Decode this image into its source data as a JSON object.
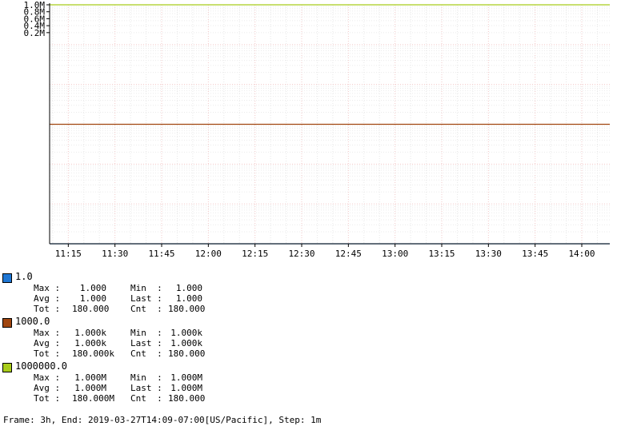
{
  "chart_data": {
    "type": "line",
    "y_axis": {
      "tick_labels": [
        "0.2M",
        "0.4M",
        "0.6M",
        "0.8M",
        "1.0M"
      ],
      "tick_values": [
        200000,
        400000,
        600000,
        800000,
        1000000
      ],
      "scale": "log",
      "ylim": [
        1,
        1000000
      ]
    },
    "x_axis": {
      "tick_labels": [
        "11:15",
        "11:30",
        "11:45",
        "12:00",
        "12:15",
        "12:30",
        "12:45",
        "13:00",
        "13:15",
        "13:30",
        "13:45",
        "14:00"
      ],
      "start": "11:09",
      "end": "14:09"
    },
    "grid": true,
    "series": [
      {
        "name": "1.0",
        "color": "#1f77d4",
        "value": 1,
        "stats": {
          "max": "1.000",
          "min": "1.000",
          "avg": "1.000",
          "last": "1.000",
          "tot": "180.000",
          "cnt": "180.000"
        }
      },
      {
        "name": "1000.0",
        "color": "#a0450f",
        "value": 1000,
        "stats": {
          "max": "1.000k",
          "min": "1.000k",
          "avg": "1.000k",
          "last": "1.000k",
          "tot": "180.000k",
          "cnt": "180.000"
        }
      },
      {
        "name": "1000000.0",
        "color": "#a8cc1a",
        "value": 1000000,
        "stats": {
          "max": "1.000M",
          "min": "1.000M",
          "avg": "1.000M",
          "last": "1.000M",
          "tot": "180.000M",
          "cnt": "180.000"
        }
      }
    ]
  },
  "stat_labels": {
    "max": "Max :",
    "min": "Min  :",
    "avg": "Avg :",
    "last": "Last :",
    "tot": "Tot :",
    "cnt": "Cnt  :"
  },
  "footer": "Frame: 3h, End: 2019-03-27T14:09-07:00[US/Pacific], Step: 1m"
}
